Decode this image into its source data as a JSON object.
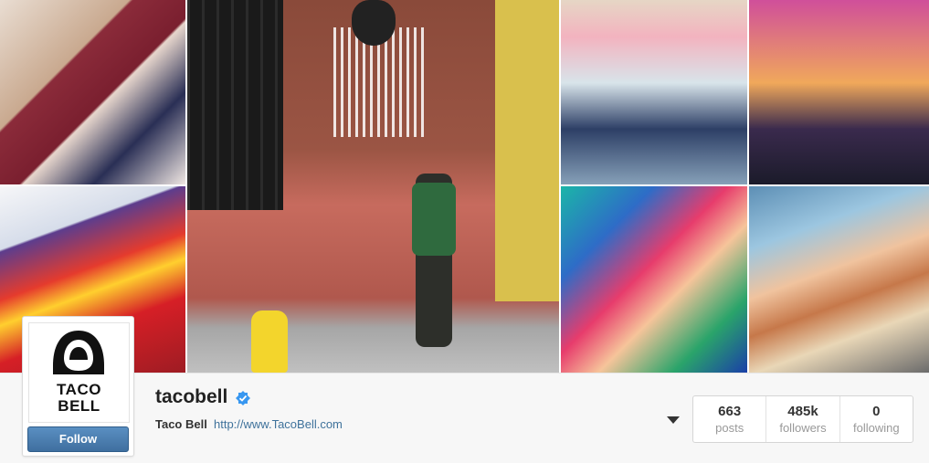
{
  "profile": {
    "username": "tacobell",
    "full_name": "Taco Bell",
    "website": "http://www.TacoBell.com",
    "logo_line1": "TACO",
    "logo_line2": "BELL",
    "verified": true,
    "follow_label": "Follow"
  },
  "stats": [
    {
      "value": "663",
      "label": "posts"
    },
    {
      "value": "485k",
      "label": "followers"
    },
    {
      "value": "0",
      "label": "following"
    }
  ],
  "photos": [
    {
      "name": "photo-hat-phone-drink"
    },
    {
      "name": "photo-fire-sauce-packets"
    },
    {
      "name": "photo-brick-wall-hydrant"
    },
    {
      "name": "photo-carousel-balloons"
    },
    {
      "name": "photo-restaurant-sunset"
    },
    {
      "name": "photo-flash-tattoos"
    },
    {
      "name": "photo-quesadilla-hand"
    }
  ],
  "colors": {
    "follow_button": "#4a7fb3",
    "link": "#3f729b",
    "verified_badge": "#3897f0"
  }
}
